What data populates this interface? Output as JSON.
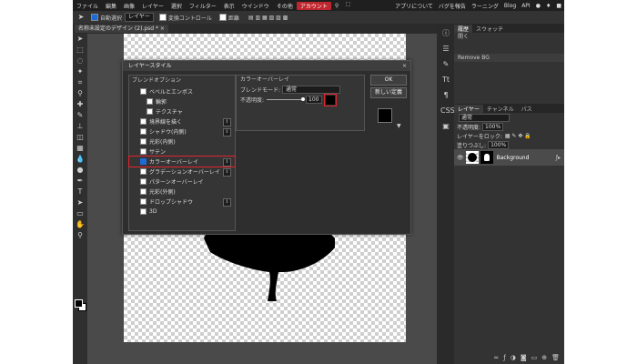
{
  "menubar": {
    "items": [
      "ファイル",
      "編集",
      "画像",
      "レイヤー",
      "選択",
      "フィルター",
      "表示",
      "ウインドウ",
      "その他",
      "アカウント"
    ],
    "right": [
      "アプリについて",
      "バグを報告",
      "ラーニング",
      "Blog",
      "API"
    ]
  },
  "optbar": {
    "auto_select": "自動選択",
    "layer_select": "レイヤー",
    "transform": "変換コントロール",
    "distance": "距離"
  },
  "doc_tab": "名称未設定のデザイン (2).psd *",
  "history_panel": {
    "tabs": [
      "履歴",
      "スウォッチ"
    ],
    "items": [
      "開く",
      "Remove BG"
    ]
  },
  "layers_panel": {
    "tabs": [
      "レイヤー",
      "チャンネル",
      "パス"
    ],
    "blend_mode": "通常",
    "opacity_label": "不透明度:",
    "opacity_value": "100%",
    "lock_label": "レイヤーをロック:",
    "fill_label": "塗りつぶし:",
    "fill_value": "100%",
    "layer_name": "Background"
  },
  "dialog": {
    "title": "レイヤースタイル",
    "blend_options": "ブレンドオプション",
    "items": [
      {
        "label": "ベベルとエンボス",
        "checked": false,
        "stepper": false,
        "sub": false
      },
      {
        "label": "輪郭",
        "checked": false,
        "stepper": false,
        "sub": true
      },
      {
        "label": "テクスチャ",
        "checked": false,
        "stepper": false,
        "sub": true
      },
      {
        "label": "境界線を描く",
        "checked": false,
        "stepper": true,
        "sub": false
      },
      {
        "label": "シャドウ(内側)",
        "checked": false,
        "stepper": true,
        "sub": false
      },
      {
        "label": "光彩(内側)",
        "checked": false,
        "stepper": false,
        "sub": false
      },
      {
        "label": "サテン",
        "checked": false,
        "stepper": false,
        "sub": false
      },
      {
        "label": "カラーオーバーレイ",
        "checked": true,
        "stepper": true,
        "sub": false,
        "highlight": true
      },
      {
        "label": "グラデーションオーバーレイ",
        "checked": false,
        "stepper": true,
        "sub": false
      },
      {
        "label": "パターンオーバーレイ",
        "checked": false,
        "stepper": false,
        "sub": false
      },
      {
        "label": "光彩(外側)",
        "checked": false,
        "stepper": false,
        "sub": false
      },
      {
        "label": "ドロップシャドウ",
        "checked": false,
        "stepper": true,
        "sub": false
      },
      {
        "label": "3D",
        "checked": false,
        "stepper": false,
        "sub": false
      }
    ],
    "section_title": "カラーオーバーレイ",
    "blend_mode_label": "ブレンドモード:",
    "blend_mode_value": "通常",
    "opacity_label": "不透明度:",
    "opacity_value": "100",
    "ok": "OK",
    "new_style": "新しい定義",
    "overlay_color": "#000000"
  }
}
